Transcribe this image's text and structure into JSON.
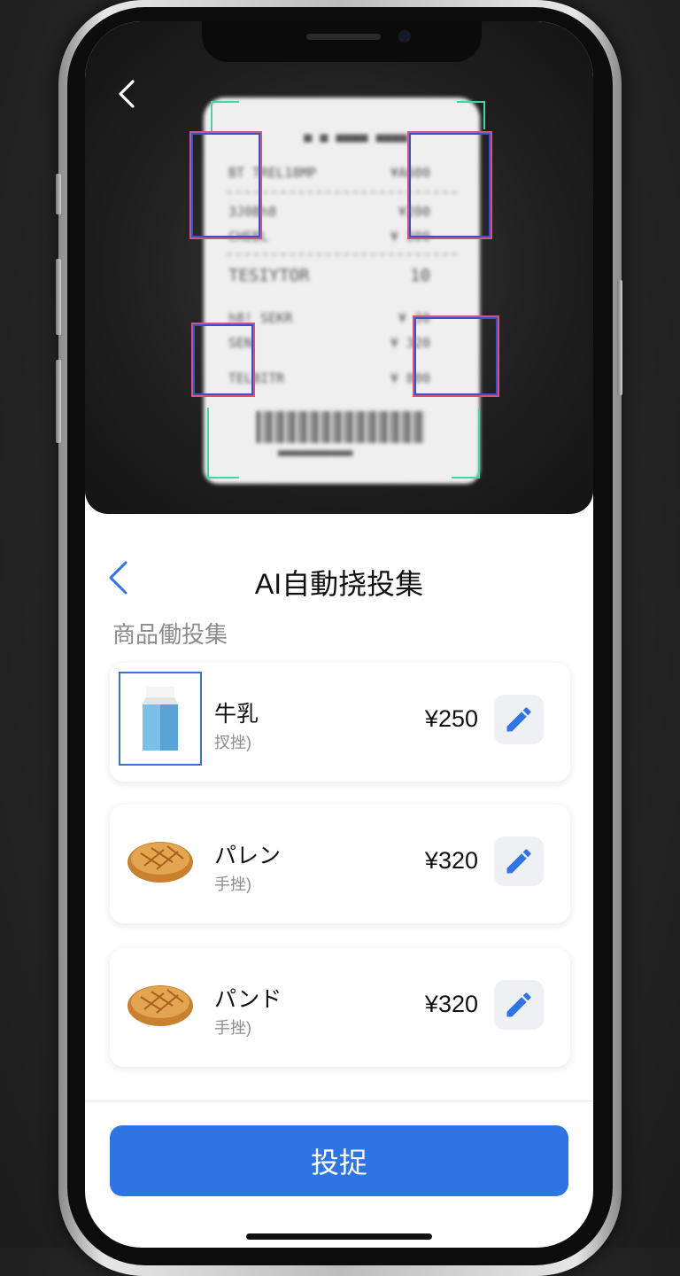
{
  "camera": {
    "back_icon": "chevron-left-icon",
    "receipt_lines": [
      {
        "left": "BT TREL18MP",
        "right": "¥A600"
      },
      {
        "left": "3J0Bh8",
        "right": "¥200"
      },
      {
        "left": "CHEBL",
        "right": "¥ 300"
      },
      {
        "left": "TESIYTOR",
        "right": "10"
      },
      {
        "left": "h8! SEKR",
        "right": "¥ 30"
      },
      {
        "left": "SEN",
        "right": "¥ 320"
      },
      {
        "left": "TELBITR",
        "right": "¥ 800"
      }
    ],
    "receipt_header": "■ ■ ■■■■ ■■■■",
    "barcode_caption": "■■■■■■■■■■■■■■"
  },
  "header": {
    "title": "AI自動挠投集",
    "back_icon": "chevron-left-icon"
  },
  "section_label": "商品働投集",
  "items": [
    {
      "name": "牛乳",
      "sub": "扠挫)",
      "price": "¥250",
      "icon": "milk-carton-icon",
      "selected": true
    },
    {
      "name": "パレン",
      "sub": "手挫)",
      "price": "¥320",
      "icon": "bread-icon",
      "selected": false
    },
    {
      "name": "パンド",
      "sub": "手挫)",
      "price": "¥320",
      "icon": "bread-icon",
      "selected": false
    }
  ],
  "confirm_label": "投捉",
  "colors": {
    "accent": "#2f74e4",
    "bracket": "#3fd7a2",
    "detect_outer": "#d4557a",
    "detect_inner": "#3653c9"
  }
}
